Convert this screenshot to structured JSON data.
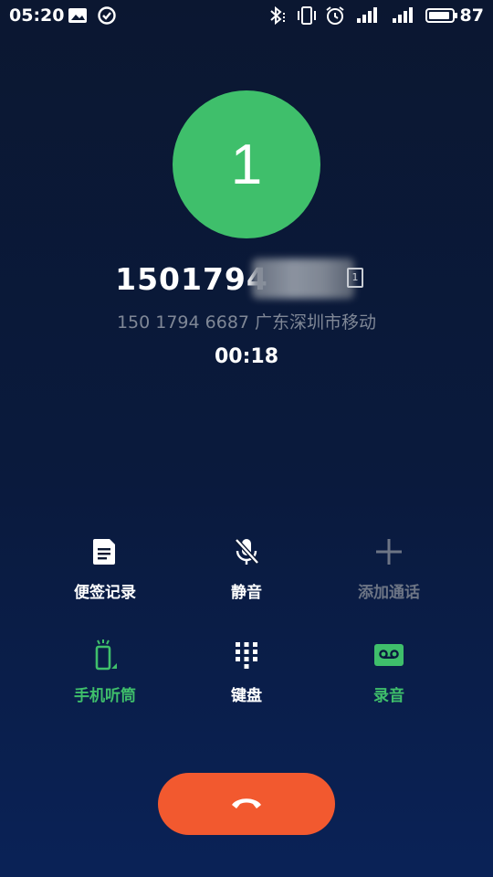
{
  "status_bar": {
    "time": "05:20",
    "battery_level": "87",
    "icons": [
      "image-icon",
      "check-circle-icon",
      "bluetooth-icon",
      "vibrate-icon",
      "alarm-icon",
      "signal-icon",
      "signal-icon",
      "battery-icon"
    ]
  },
  "caller": {
    "avatar_text": "1",
    "number_visible": "1501794",
    "sim_label": "1",
    "sub_info": "150 1794 6687  广东深圳市移动",
    "duration": "00:18"
  },
  "actions": {
    "note": "便签记录",
    "mute": "静音",
    "add_call": "添加通话",
    "handset": "手机听筒",
    "keypad": "键盘",
    "record": "录音"
  },
  "colors": {
    "accent_green": "#3fbf6b",
    "end_call": "#f2592f",
    "background_top": "#0b1731",
    "background_bottom": "#0a2257"
  }
}
